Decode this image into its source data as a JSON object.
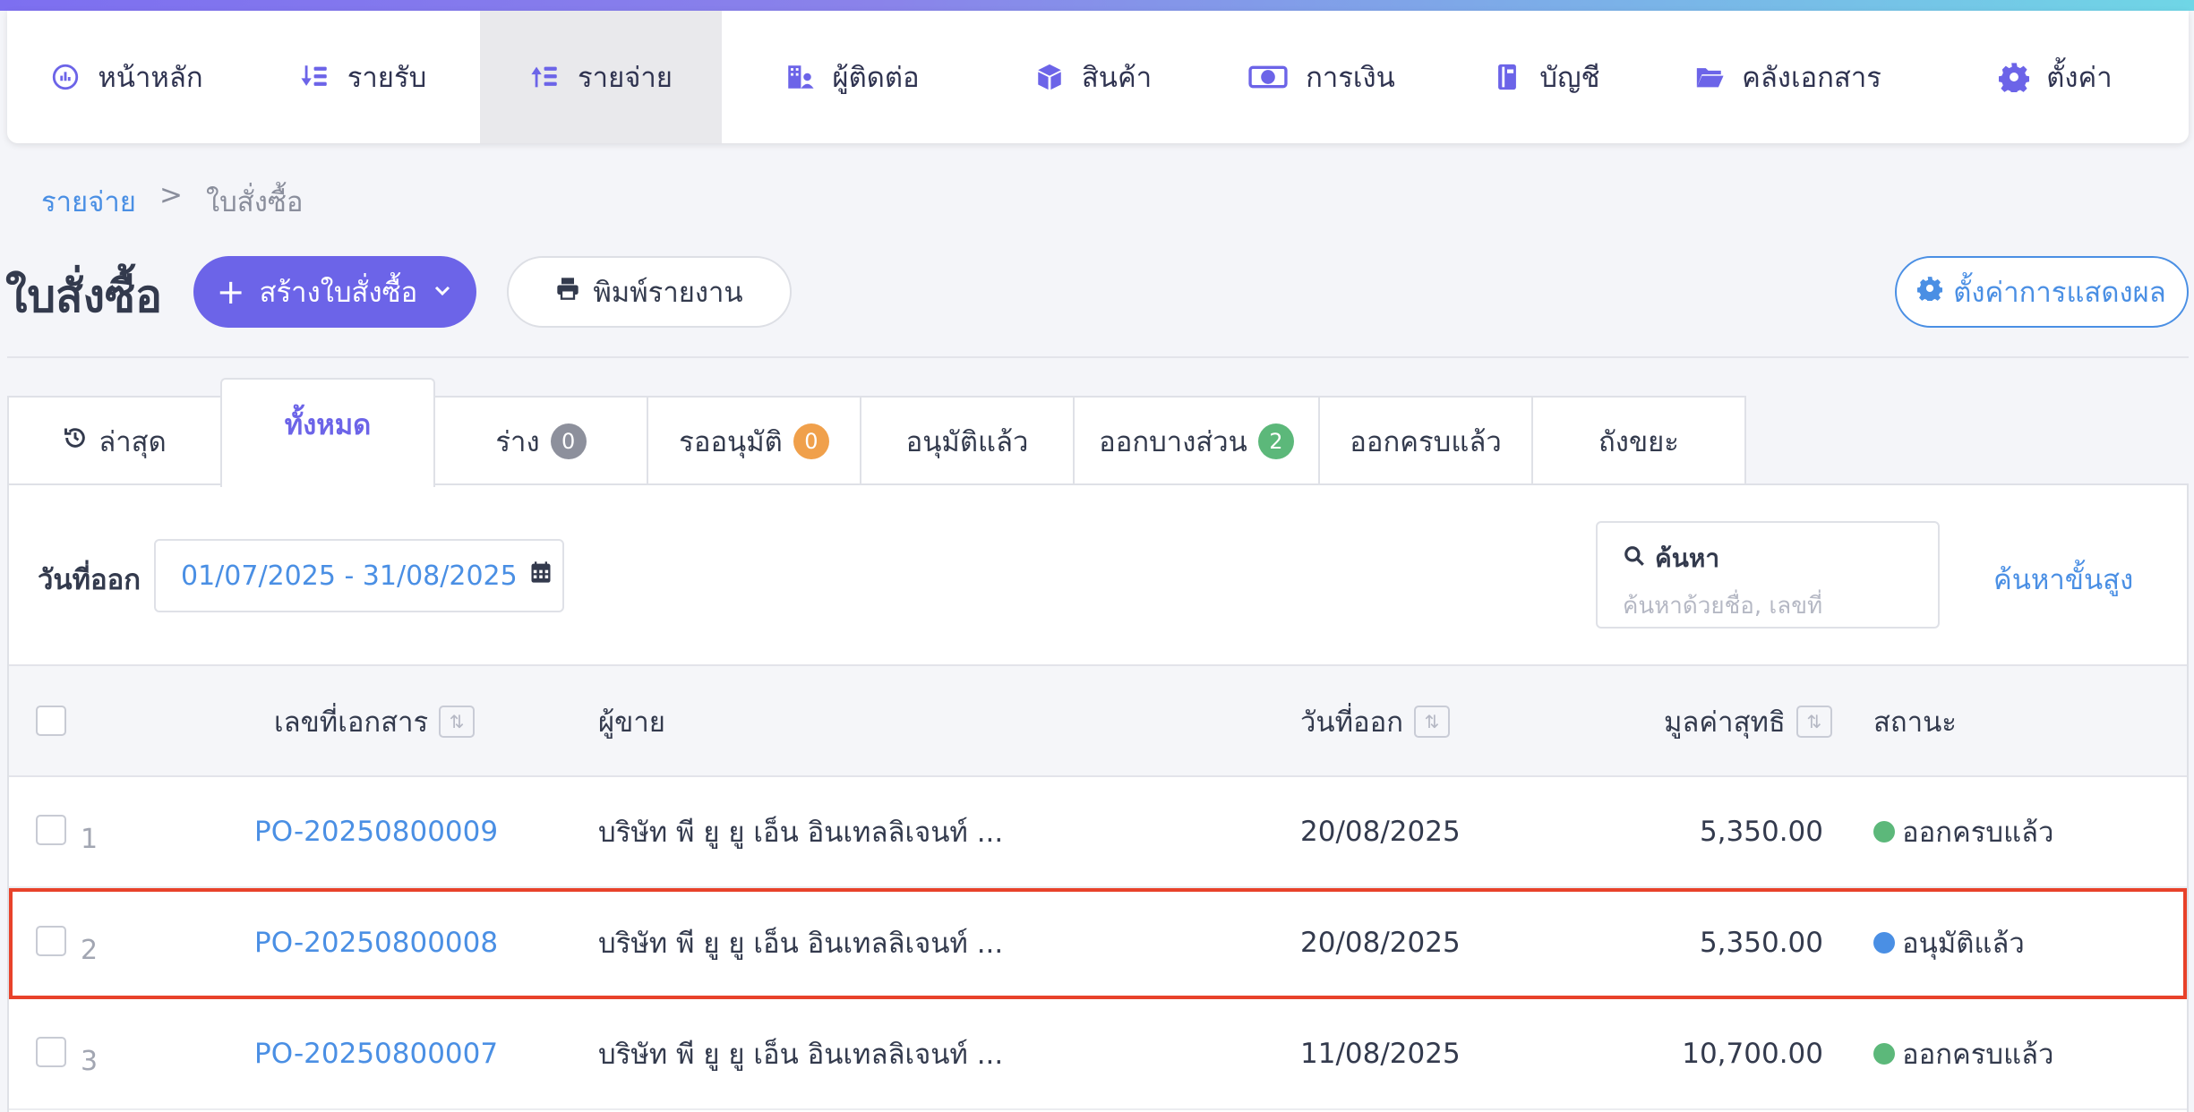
{
  "nav": {
    "items": [
      {
        "label": "หน้าหลัก",
        "icon": "dashboard-icon"
      },
      {
        "label": "รายรับ",
        "icon": "income-icon"
      },
      {
        "label": "รายจ่าย",
        "icon": "expense-icon"
      },
      {
        "label": "ผู้ติดต่อ",
        "icon": "contacts-icon"
      },
      {
        "label": "สินค้า",
        "icon": "product-box-icon"
      },
      {
        "label": "การเงิน",
        "icon": "money-icon"
      },
      {
        "label": "บัญชี",
        "icon": "ledger-icon"
      },
      {
        "label": "คลังเอกสาร",
        "icon": "folder-icon"
      },
      {
        "label": "ตั้งค่า",
        "icon": "gear-icon"
      }
    ],
    "active_index": 2
  },
  "breadcrumb": {
    "parent": "รายจ่าย",
    "separator": ">",
    "current": "ใบสั่งซื้อ"
  },
  "page": {
    "title": "ใบสั่งซื้อ",
    "create_label": "สร้างใบสั่งซื้อ",
    "print_label": "พิมพ์รายงาน",
    "display_settings_label": "ตั้งค่าการแสดงผล"
  },
  "tabs": [
    {
      "label": "ล่าสุด"
    },
    {
      "label": "ทั้งหมด"
    },
    {
      "label": "ร่าง",
      "badge": "0",
      "badge_color": "#8d909c"
    },
    {
      "label": "รออนุมัติ",
      "badge": "0",
      "badge_color": "#f0a04b"
    },
    {
      "label": "อนุมัติแล้ว"
    },
    {
      "label": "ออกบางส่วน",
      "badge": "2",
      "badge_color": "#5cb87a"
    },
    {
      "label": "ออกครบแล้ว"
    },
    {
      "label": "ถังขยะ"
    }
  ],
  "filters": {
    "date_label": "วันที่ออก",
    "date_range": "01/07/2025 - 31/08/2025",
    "search_label": "ค้นหา",
    "search_placeholder": "ค้นหาด้วยชื่อ, เลขที่",
    "advanced_search": "ค้นหาขั้นสูง"
  },
  "table": {
    "columns": {
      "doc_no": "เลขที่เอกสาร",
      "vendor": "ผู้ขาย",
      "issue_date": "วันที่ออก",
      "net_value": "มูลค่าสุทธิ",
      "status": "สถานะ"
    },
    "rows": [
      {
        "num": "1",
        "doc_no": "PO-20250800009",
        "vendor": "บริษัท พี ยู ยู เอ็น อินเทลลิเจนท์ ...",
        "date": "20/08/2025",
        "amount": "5,350.00",
        "status": "ออกครบแล้ว",
        "status_color": "#5cb87a"
      },
      {
        "num": "2",
        "doc_no": "PO-20250800008",
        "vendor": "บริษัท พี ยู ยู เอ็น อินเทลลิเจนท์ ...",
        "date": "20/08/2025",
        "amount": "5,350.00",
        "status": "อนุมัติแล้ว",
        "status_color": "#4a8fe4"
      },
      {
        "num": "3",
        "doc_no": "PO-20250800007",
        "vendor": "บริษัท พี ยู ยู เอ็น อินเทลลิเจนท์ ...",
        "date": "11/08/2025",
        "amount": "10,700.00",
        "status": "ออกครบแล้ว",
        "status_color": "#5cb87a"
      }
    ]
  },
  "colors": {
    "accent": "#6c64e8",
    "link": "#4a8fe4",
    "highlight": "#e8422a"
  }
}
